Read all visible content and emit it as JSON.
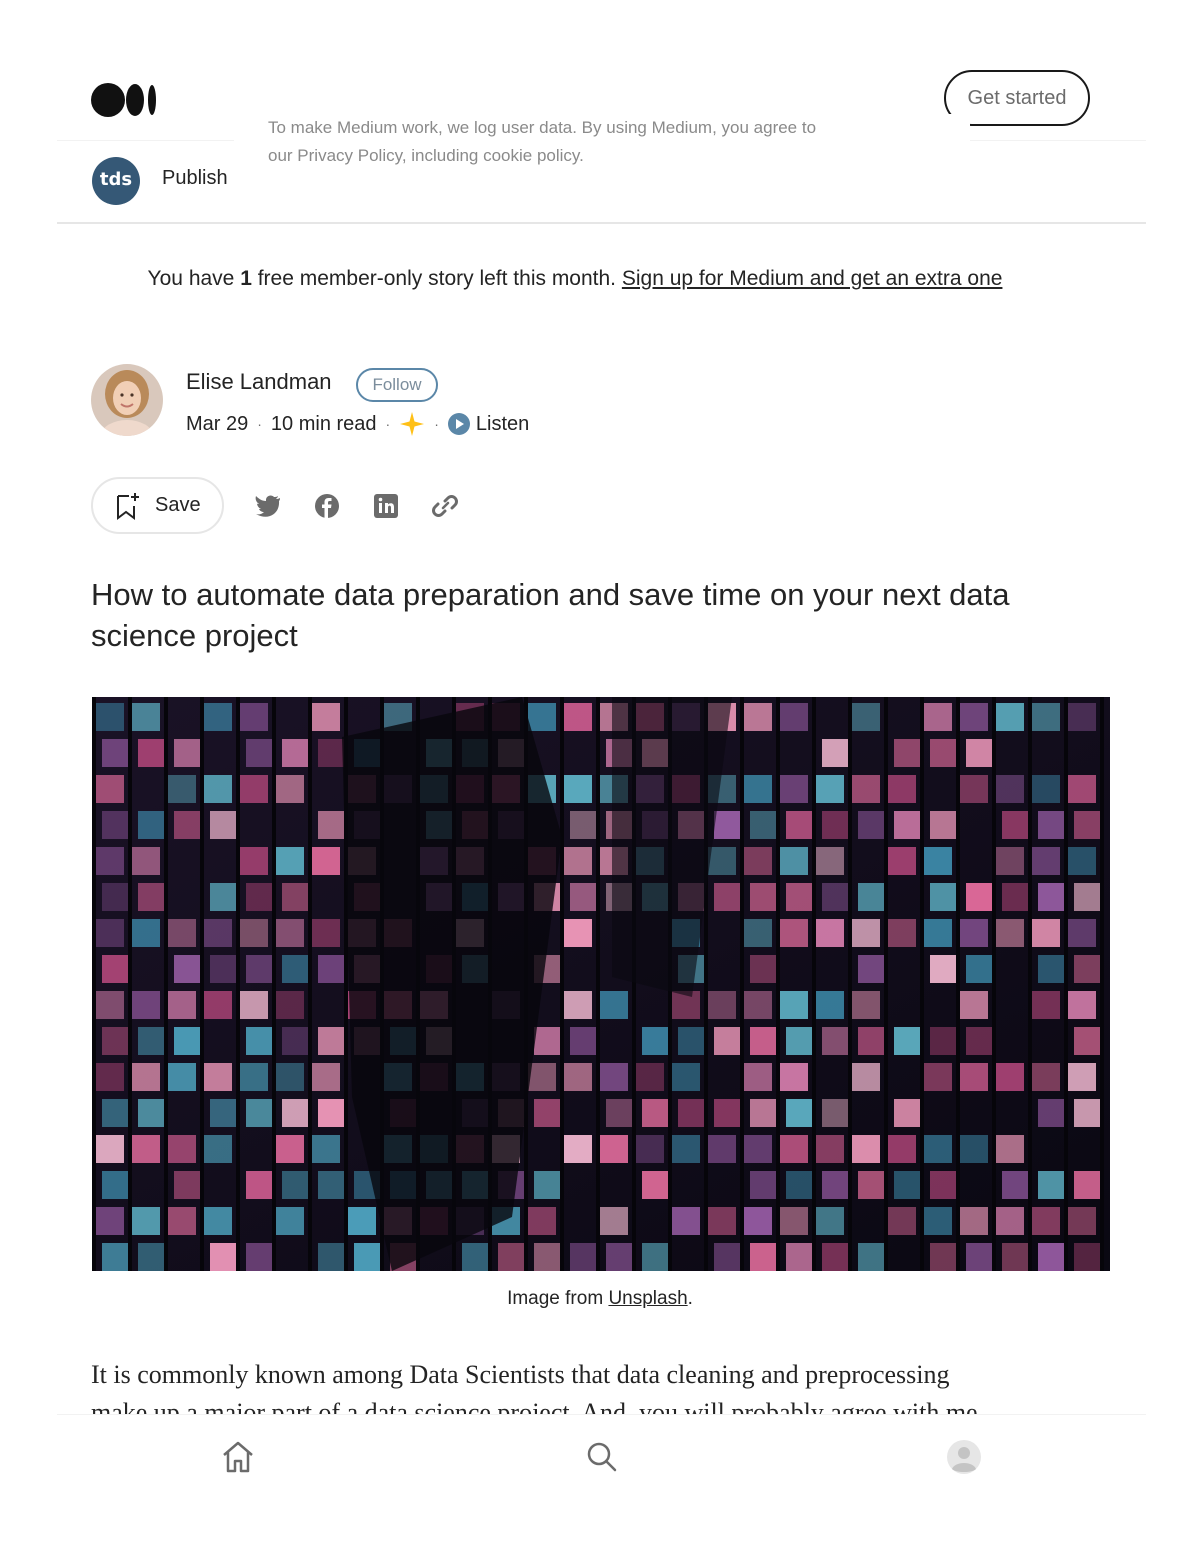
{
  "header": {
    "logo": "medium-logo",
    "get_started_label": "Get started"
  },
  "cookie_notice": {
    "line1": "To make Medium work, we log user data. By using Medium, you agree to",
    "line2": "our Privacy Policy, including cookie policy."
  },
  "publication": {
    "logo_text": "tds",
    "label": "Publish"
  },
  "member_banner": {
    "prefix": "You have ",
    "count": "1",
    "middle": " free member-only story left this month. ",
    "link": "Sign up for Medium and get an extra one"
  },
  "author": {
    "name": "Elise Landman",
    "follow_label": "Follow",
    "date": "Mar 29",
    "read_time": "10 min read",
    "dot": "·",
    "listen_label": "Listen"
  },
  "actions": {
    "save_label": "Save",
    "share_icons": [
      "twitter-icon",
      "facebook-icon",
      "linkedin-icon",
      "link-icon"
    ]
  },
  "article": {
    "title": "How to automate data preparation and save time on your next data science project",
    "caption_prefix": "Image from ",
    "caption_link": "Unsplash",
    "caption_suffix": ".",
    "body_line1": "It is commonly known among Data Scientists that data cleaning and preprocessing",
    "body_line2": "make up a major part of a data science project. And, you will probably agree with me"
  },
  "bottom_nav": {
    "items": [
      "home-icon",
      "search-icon",
      "profile-icon"
    ]
  },
  "colors": {
    "accent_blue": "#5b87a8",
    "tds_blue": "#355876",
    "text": "#242424",
    "star": "#ffc017"
  }
}
